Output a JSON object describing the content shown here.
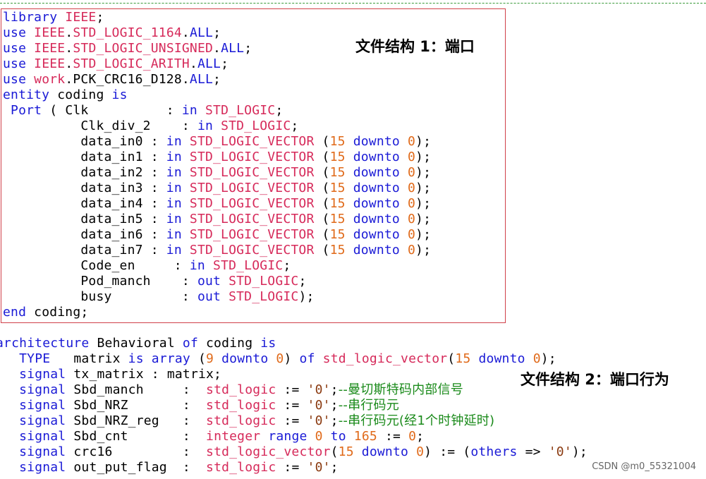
{
  "annotations": {
    "section1": "文件结构 1：端口",
    "section2": "文件结构 2：端口行为"
  },
  "watermark": "CSDN @m0_55321004",
  "colors": {
    "keyword": "#1a1ad6",
    "type": "#d62a5a",
    "number": "#e06a1a",
    "string": "#8a3a10",
    "comment": "#1a8a1a",
    "box_border": "#d0404a",
    "top_dash": "#3a9a3a"
  },
  "code_block_1": [
    [
      [
        "k",
        "library"
      ],
      [
        "",
        " "
      ],
      [
        "t",
        "IEEE"
      ],
      [
        "",
        ";"
      ]
    ],
    [
      [
        "k",
        "use"
      ],
      [
        "",
        " "
      ],
      [
        "t",
        "IEEE"
      ],
      [
        "",
        "."
      ],
      [
        "t",
        "STD_LOGIC_1164"
      ],
      [
        "",
        "."
      ],
      [
        "k",
        "ALL"
      ],
      [
        "",
        ";"
      ]
    ],
    [
      [
        "k",
        "use"
      ],
      [
        "",
        " "
      ],
      [
        "t",
        "IEEE"
      ],
      [
        "",
        "."
      ],
      [
        "t",
        "STD_LOGIC_UNSIGNED"
      ],
      [
        "",
        "."
      ],
      [
        "k",
        "ALL"
      ],
      [
        "",
        ";"
      ]
    ],
    [
      [
        "k",
        "use"
      ],
      [
        "",
        " "
      ],
      [
        "t",
        "IEEE"
      ],
      [
        "",
        "."
      ],
      [
        "t",
        "STD_LOGIC_ARITH"
      ],
      [
        "",
        "."
      ],
      [
        "k",
        "ALL"
      ],
      [
        "",
        ";"
      ]
    ],
    [
      [
        "k",
        "use"
      ],
      [
        "",
        " "
      ],
      [
        "t",
        "work"
      ],
      [
        "",
        ".PCK_CRC16_D128."
      ],
      [
        "k",
        "ALL"
      ],
      [
        "",
        ";"
      ]
    ],
    [
      [
        "k",
        "entity"
      ],
      [
        "",
        " coding "
      ],
      [
        "k",
        "is"
      ]
    ],
    [
      [
        "",
        " "
      ],
      [
        "k",
        "Port"
      ],
      [
        "",
        " ( Clk          : "
      ],
      [
        "k",
        "in"
      ],
      [
        "",
        " "
      ],
      [
        "t",
        "STD_LOGIC"
      ],
      [
        "",
        ";"
      ]
    ],
    [
      [
        "",
        "          Clk_div_2    : "
      ],
      [
        "k",
        "in"
      ],
      [
        "",
        " "
      ],
      [
        "t",
        "STD_LOGIC"
      ],
      [
        "",
        ";"
      ]
    ],
    [
      [
        "",
        "          data_in0 : "
      ],
      [
        "k",
        "in"
      ],
      [
        "",
        " "
      ],
      [
        "t",
        "STD_LOGIC_VECTOR"
      ],
      [
        "",
        " ("
      ],
      [
        "n",
        "15"
      ],
      [
        "",
        " "
      ],
      [
        "k",
        "downto"
      ],
      [
        "",
        " "
      ],
      [
        "n",
        "0"
      ],
      [
        "",
        ");"
      ]
    ],
    [
      [
        "",
        "          data_in1 : "
      ],
      [
        "k",
        "in"
      ],
      [
        "",
        " "
      ],
      [
        "t",
        "STD_LOGIC_VECTOR"
      ],
      [
        "",
        " ("
      ],
      [
        "n",
        "15"
      ],
      [
        "",
        " "
      ],
      [
        "k",
        "downto"
      ],
      [
        "",
        " "
      ],
      [
        "n",
        "0"
      ],
      [
        "",
        ");"
      ]
    ],
    [
      [
        "",
        "          data_in2 : "
      ],
      [
        "k",
        "in"
      ],
      [
        "",
        " "
      ],
      [
        "t",
        "STD_LOGIC_VECTOR"
      ],
      [
        "",
        " ("
      ],
      [
        "n",
        "15"
      ],
      [
        "",
        " "
      ],
      [
        "k",
        "downto"
      ],
      [
        "",
        " "
      ],
      [
        "n",
        "0"
      ],
      [
        "",
        ");"
      ]
    ],
    [
      [
        "",
        "          data_in3 : "
      ],
      [
        "k",
        "in"
      ],
      [
        "",
        " "
      ],
      [
        "t",
        "STD_LOGIC_VECTOR"
      ],
      [
        "",
        " ("
      ],
      [
        "n",
        "15"
      ],
      [
        "",
        " "
      ],
      [
        "k",
        "downto"
      ],
      [
        "",
        " "
      ],
      [
        "n",
        "0"
      ],
      [
        "",
        ");"
      ]
    ],
    [
      [
        "",
        "          data_in4 : "
      ],
      [
        "k",
        "in"
      ],
      [
        "",
        " "
      ],
      [
        "t",
        "STD_LOGIC_VECTOR"
      ],
      [
        "",
        " ("
      ],
      [
        "n",
        "15"
      ],
      [
        "",
        " "
      ],
      [
        "k",
        "downto"
      ],
      [
        "",
        " "
      ],
      [
        "n",
        "0"
      ],
      [
        "",
        ");"
      ]
    ],
    [
      [
        "",
        "          data_in5 : "
      ],
      [
        "k",
        "in"
      ],
      [
        "",
        " "
      ],
      [
        "t",
        "STD_LOGIC_VECTOR"
      ],
      [
        "",
        " ("
      ],
      [
        "n",
        "15"
      ],
      [
        "",
        " "
      ],
      [
        "k",
        "downto"
      ],
      [
        "",
        " "
      ],
      [
        "n",
        "0"
      ],
      [
        "",
        ");"
      ]
    ],
    [
      [
        "",
        "          data_in6 : "
      ],
      [
        "k",
        "in"
      ],
      [
        "",
        " "
      ],
      [
        "t",
        "STD_LOGIC_VECTOR"
      ],
      [
        "",
        " ("
      ],
      [
        "n",
        "15"
      ],
      [
        "",
        " "
      ],
      [
        "k",
        "downto"
      ],
      [
        "",
        " "
      ],
      [
        "n",
        "0"
      ],
      [
        "",
        ");"
      ]
    ],
    [
      [
        "",
        "          data_in7 : "
      ],
      [
        "k",
        "in"
      ],
      [
        "",
        " "
      ],
      [
        "t",
        "STD_LOGIC_VECTOR"
      ],
      [
        "",
        " ("
      ],
      [
        "n",
        "15"
      ],
      [
        "",
        " "
      ],
      [
        "k",
        "downto"
      ],
      [
        "",
        " "
      ],
      [
        "n",
        "0"
      ],
      [
        "",
        ");"
      ]
    ],
    [
      [
        "",
        "          Code_en     : "
      ],
      [
        "k",
        "in"
      ],
      [
        "",
        " "
      ],
      [
        "t",
        "STD_LOGIC"
      ],
      [
        "",
        ";"
      ]
    ],
    [
      [
        "",
        "          Pod_manch    : "
      ],
      [
        "k",
        "out"
      ],
      [
        "",
        " "
      ],
      [
        "t",
        "STD_LOGIC"
      ],
      [
        "",
        ";"
      ]
    ],
    [
      [
        "",
        "          busy         : "
      ],
      [
        "k",
        "out"
      ],
      [
        "",
        " "
      ],
      [
        "t",
        "STD_LOGIC"
      ],
      [
        "",
        ");"
      ]
    ],
    [
      [
        "k",
        "end"
      ],
      [
        "",
        " coding;"
      ]
    ]
  ],
  "code_block_2": [
    [
      [
        "k",
        "architecture"
      ],
      [
        "",
        " Behavioral "
      ],
      [
        "k",
        "of"
      ],
      [
        "",
        " coding "
      ],
      [
        "k",
        "is"
      ]
    ],
    [
      [
        "",
        "   "
      ],
      [
        "k",
        "TYPE"
      ],
      [
        "",
        "   matrix "
      ],
      [
        "k",
        "is"
      ],
      [
        "",
        " "
      ],
      [
        "k",
        "array"
      ],
      [
        "",
        " ("
      ],
      [
        "n",
        "9"
      ],
      [
        "",
        " "
      ],
      [
        "k",
        "downto"
      ],
      [
        "",
        " "
      ],
      [
        "n",
        "0"
      ],
      [
        "",
        ") "
      ],
      [
        "k",
        "of"
      ],
      [
        "",
        " "
      ],
      [
        "t",
        "std_logic_vector"
      ],
      [
        "",
        "("
      ],
      [
        "n",
        "15"
      ],
      [
        "",
        " "
      ],
      [
        "k",
        "downto"
      ],
      [
        "",
        " "
      ],
      [
        "n",
        "0"
      ],
      [
        "",
        ");"
      ]
    ],
    [
      [
        "",
        "   "
      ],
      [
        "k",
        "signal"
      ],
      [
        "",
        " tx_matrix : matrix;"
      ]
    ],
    [
      [
        "",
        "   "
      ],
      [
        "k",
        "signal"
      ],
      [
        "",
        " Sbd_manch     :  "
      ],
      [
        "t",
        "std_logic"
      ],
      [
        "",
        " := "
      ],
      [
        "s",
        "'0'"
      ],
      [
        "",
        ";"
      ],
      [
        "c",
        "--曼切斯特码内部信号"
      ]
    ],
    [
      [
        "",
        "   "
      ],
      [
        "k",
        "signal"
      ],
      [
        "",
        " Sbd_NRZ       :  "
      ],
      [
        "t",
        "std_logic"
      ],
      [
        "",
        " := "
      ],
      [
        "s",
        "'0'"
      ],
      [
        "",
        ";"
      ],
      [
        "c",
        "--串行码元"
      ]
    ],
    [
      [
        "",
        "   "
      ],
      [
        "k",
        "signal"
      ],
      [
        "",
        " Sbd_NRZ_reg   :  "
      ],
      [
        "t",
        "std_logic"
      ],
      [
        "",
        " := "
      ],
      [
        "s",
        "'0'"
      ],
      [
        "",
        ";"
      ],
      [
        "c",
        "--串行码元(经1个时钟延时)"
      ]
    ],
    [
      [
        "",
        "   "
      ],
      [
        "k",
        "signal"
      ],
      [
        "",
        " Sbd_cnt       :  "
      ],
      [
        "t",
        "integer"
      ],
      [
        "",
        " "
      ],
      [
        "k",
        "range"
      ],
      [
        "",
        " "
      ],
      [
        "n",
        "0"
      ],
      [
        "",
        " "
      ],
      [
        "k",
        "to"
      ],
      [
        "",
        " "
      ],
      [
        "n",
        "165"
      ],
      [
        "",
        " := "
      ],
      [
        "n",
        "0"
      ],
      [
        "",
        ";"
      ]
    ],
    [
      [
        "",
        "   "
      ],
      [
        "k",
        "signal"
      ],
      [
        "",
        " crc16         :  "
      ],
      [
        "t",
        "std_logic_vector"
      ],
      [
        "",
        "("
      ],
      [
        "n",
        "15"
      ],
      [
        "",
        " "
      ],
      [
        "k",
        "downto"
      ],
      [
        "",
        " "
      ],
      [
        "n",
        "0"
      ],
      [
        "",
        ") := ("
      ],
      [
        "k",
        "others"
      ],
      [
        "",
        " => "
      ],
      [
        "s",
        "'0'"
      ],
      [
        "",
        ");"
      ]
    ],
    [
      [
        "",
        "   "
      ],
      [
        "k",
        "signal"
      ],
      [
        "",
        " out_put_flag  :  "
      ],
      [
        "t",
        "std_logic"
      ],
      [
        "",
        " := "
      ],
      [
        "s",
        "'0'"
      ],
      [
        "",
        ";"
      ]
    ]
  ]
}
